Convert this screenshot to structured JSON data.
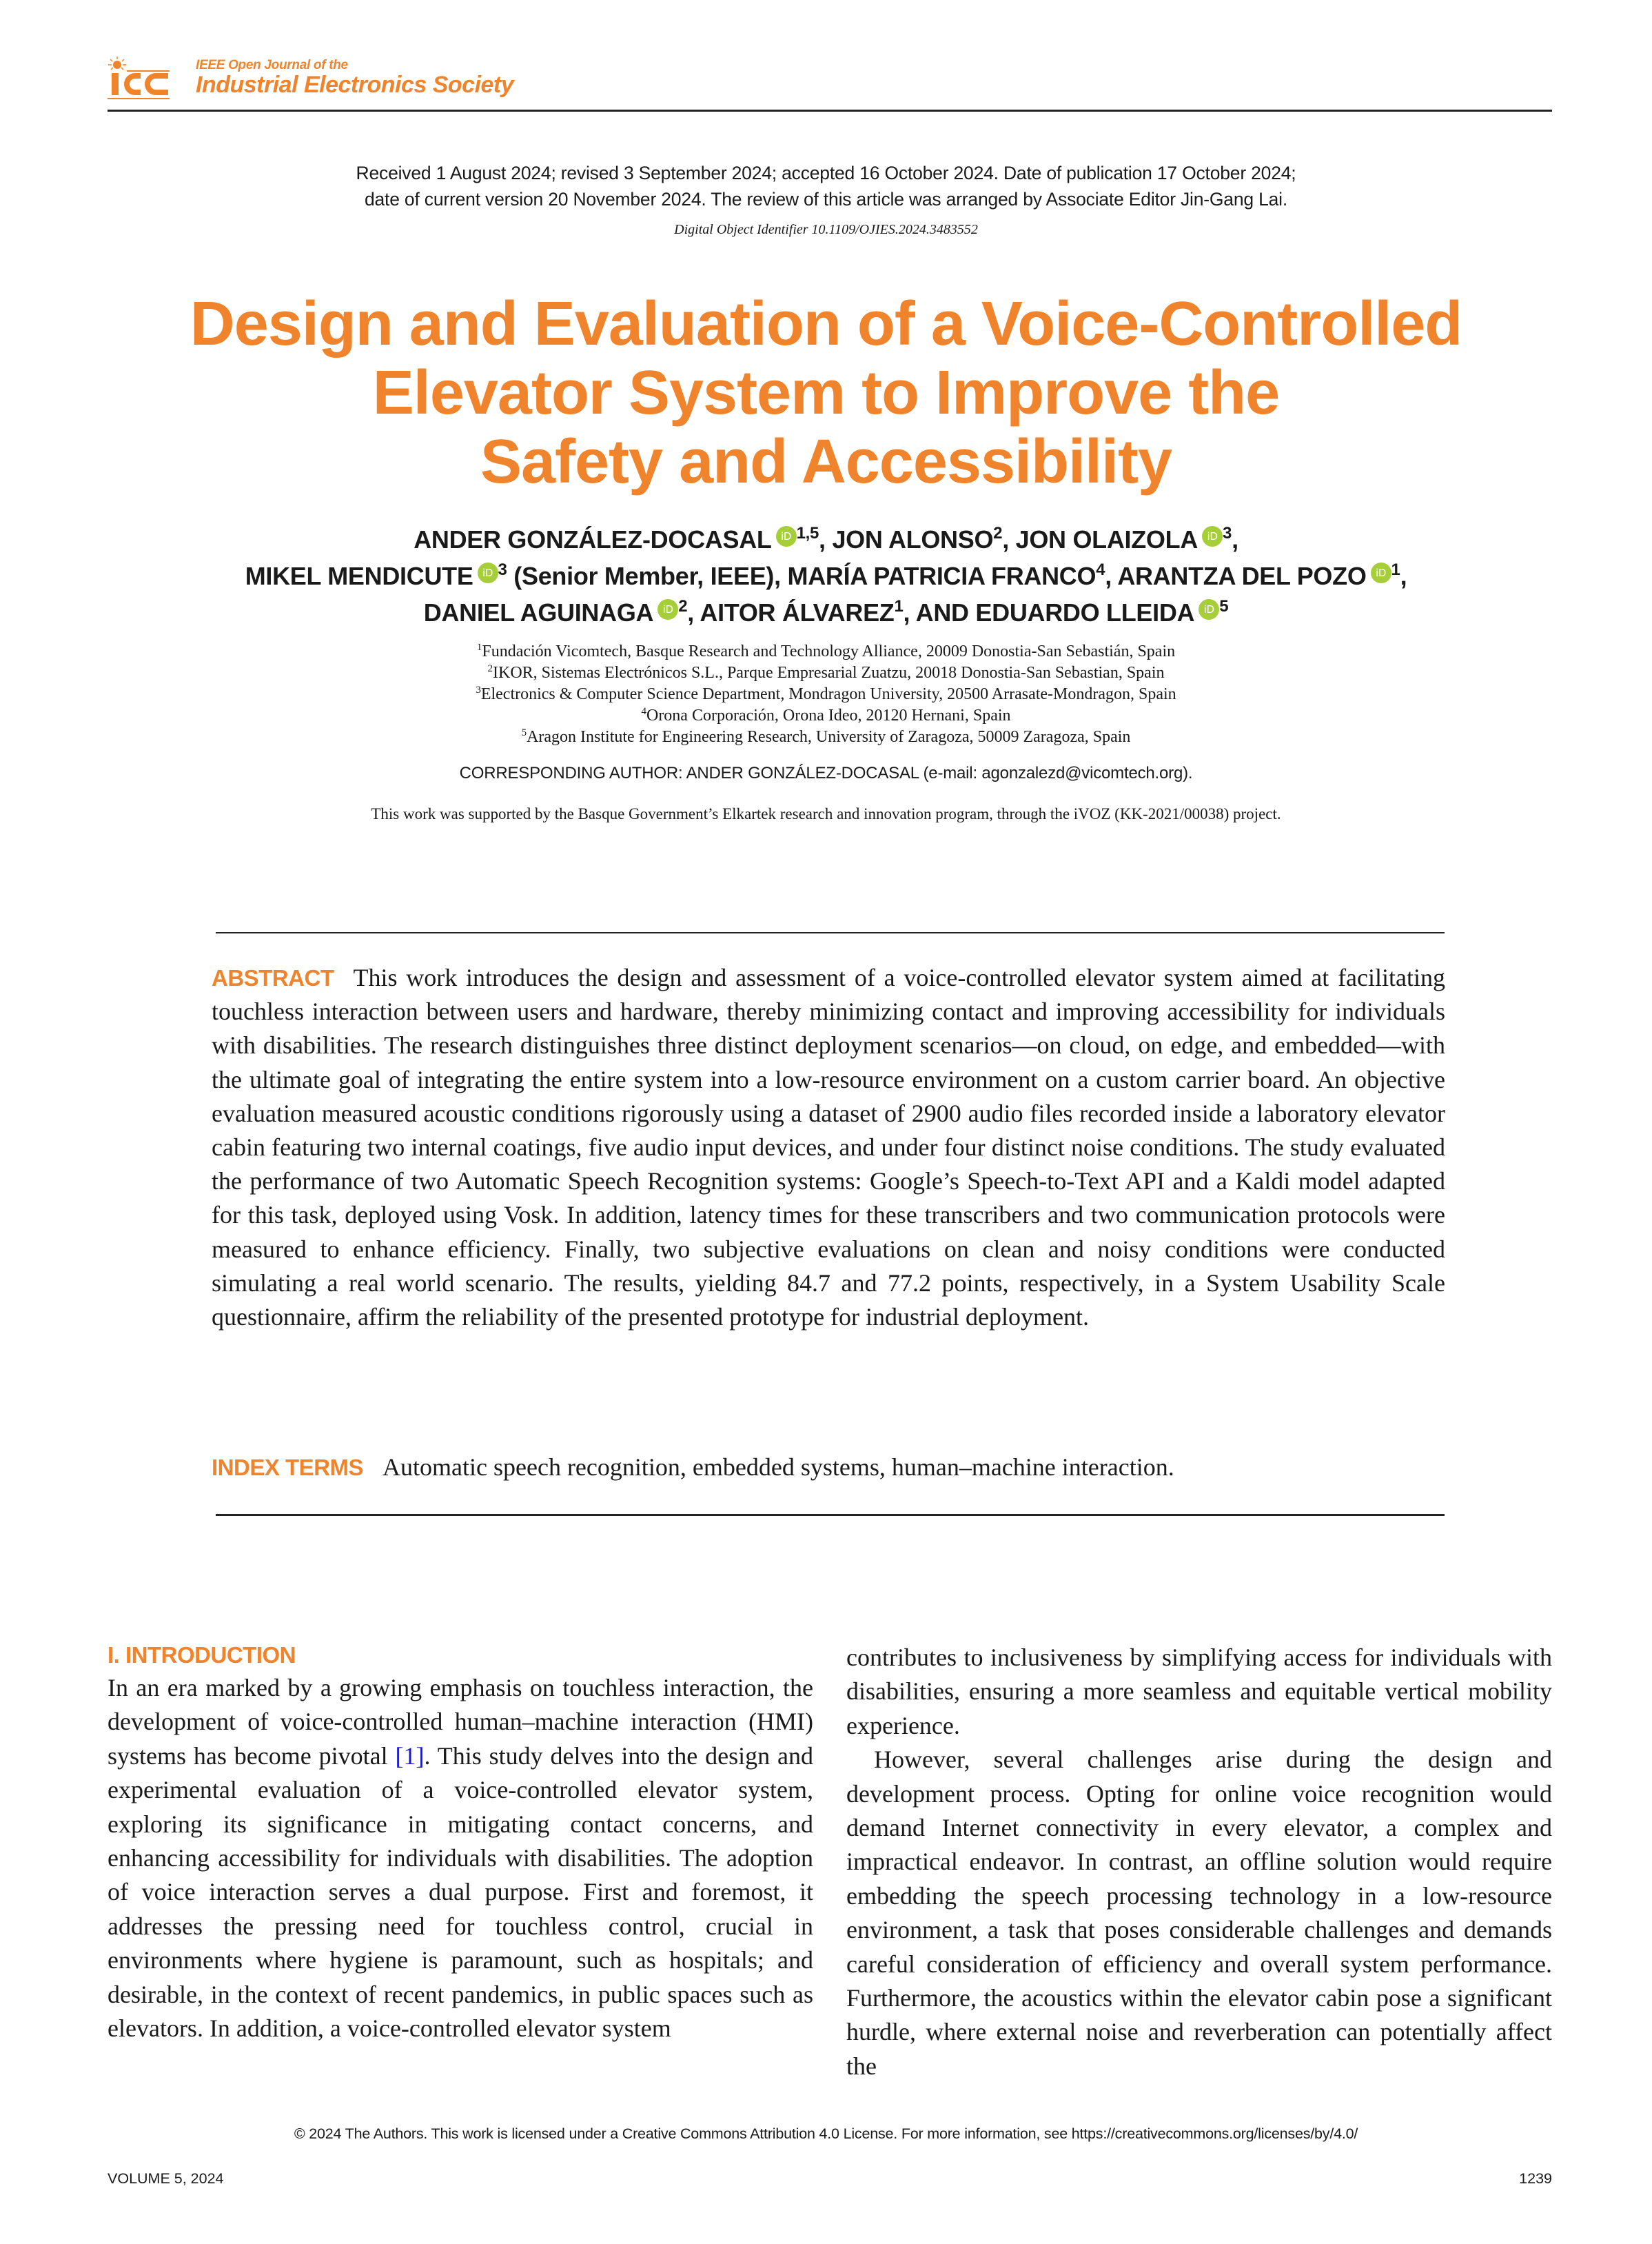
{
  "header": {
    "logo_icon": "ies-logo-icon",
    "journal_line1": "IEEE Open Journal of the",
    "journal_line2": "Industrial Electronics Society"
  },
  "received": {
    "line1": "Received 1 August 2024; revised 3 September 2024; accepted 16 October 2024. Date of publication 17 October 2024;",
    "line2": "date of current version 20 November 2024. The review of this article was arranged by Associate Editor Jin-Gang Lai.",
    "doi": "Digital Object Identifier 10.1109/OJIES.2024.3483552"
  },
  "title": {
    "line1": "Design and Evaluation of a Voice-Controlled",
    "line2": "Elevator System to Improve the",
    "line3": "Safety and Accessibility"
  },
  "authors": [
    {
      "name": "ANDER GONZÁLEZ-DOCASAL",
      "orcid": true,
      "aff": "1,5",
      "suffix": ","
    },
    {
      "name": "JON ALONSO",
      "orcid": false,
      "aff": "2",
      "suffix": ","
    },
    {
      "name": "JON OLAIZOLA",
      "orcid": true,
      "aff": "3",
      "suffix": ","
    },
    {
      "name": "MIKEL MENDICUTE",
      "orcid": true,
      "aff": "3",
      "suffix": " (Senior Member, IEEE),"
    },
    {
      "name": "MARÍA PATRICIA FRANCO",
      "orcid": false,
      "aff": "4",
      "suffix": ","
    },
    {
      "name": "ARANTZA DEL POZO",
      "orcid": true,
      "aff": "1",
      "suffix": ","
    },
    {
      "name": "DANIEL AGUINAGA",
      "orcid": true,
      "aff": "2",
      "suffix": ","
    },
    {
      "name": "AITOR ÁLVAREZ",
      "orcid": false,
      "aff": "1",
      "suffix": ","
    },
    {
      "name": "AND EDUARDO LLEIDA",
      "orcid": true,
      "aff": "5",
      "suffix": ""
    }
  ],
  "orcid_label": "iD",
  "affiliations": [
    {
      "num": "1",
      "text": "Fundación Vicomtech, Basque Research and Technology Alliance, 20009 Donostia-San Sebastián, Spain"
    },
    {
      "num": "2",
      "text": "IKOR, Sistemas Electrónicos S.L., Parque Empresarial Zuatzu, 20018 Donostia-San Sebastian, Spain"
    },
    {
      "num": "3",
      "text": "Electronics & Computer Science Department, Mondragon University, 20500 Arrasate-Mondragon, Spain"
    },
    {
      "num": "4",
      "text": "Orona Corporación, Orona Ideo, 20120 Hernani, Spain"
    },
    {
      "num": "5",
      "text": "Aragon Institute for Engineering Research, University of Zaragoza, 50009 Zaragoza, Spain"
    }
  ],
  "corresponding": "CORRESPONDING AUTHOR: ANDER GONZÁLEZ-DOCASAL (e-mail: agonzalezd@vicomtech.org).",
  "funding": "This work was supported by the Basque Government’s Elkartek research and innovation program, through the iVOZ (KK-2021/00038) project.",
  "abstract": {
    "label": "ABSTRACT",
    "text": "This work introduces the design and assessment of a voice-controlled elevator system aimed at facilitating touchless interaction between users and hardware, thereby minimizing contact and improving accessibility for individuals with disabilities. The research distinguishes three distinct deployment scenarios—on cloud, on edge, and embedded—with the ultimate goal of integrating the entire system into a low-resource environment on a custom carrier board. An objective evaluation measured acoustic conditions rigorously using a dataset of 2900 audio files recorded inside a laboratory elevator cabin featuring two internal coatings, five audio input devices, and under four distinct noise conditions. The study evaluated the performance of two Automatic Speech Recognition systems: Google’s Speech-to-Text API and a Kaldi model adapted for this task, deployed using Vosk. In addition, latency times for these transcribers and two communication protocols were measured to enhance efficiency. Finally, two subjective evaluations on clean and noisy conditions were conducted simulating a real world scenario. The results, yielding 84.7 and 77.2 points, respectively, in a System Usability Scale questionnaire, affirm the reliability of the presented prototype for industrial deployment."
  },
  "index_terms": {
    "label": "INDEX TERMS",
    "text": "Automatic speech recognition, embedded systems, human–machine interaction."
  },
  "introduction": {
    "heading": "I. INTRODUCTION",
    "p1_before_cite": "In an era marked by a growing emphasis on touchless interaction, the development of voice-controlled human–machine interaction (HMI) systems has become pivotal ",
    "p1_cite": "[1]",
    "p1_after_cite": ". This study delves into the design and experimental evaluation of a voice-controlled elevator system, exploring its significance in mitigating contact concerns, and enhancing accessibility for individuals with disabilities. The adoption of voice interaction serves a dual purpose. First and foremost, it addresses the pressing need for touchless control, crucial in environments where hygiene is paramount, such as hospitals; and desirable, in the context of recent pandemics, in public spaces such as elevators. In addition, a voice-controlled elevator system",
    "p1_continued": "contributes to inclusiveness by simplifying access for individuals with disabilities, ensuring a more seamless and equitable vertical mobility experience.",
    "p2": "However, several challenges arise during the design and development process. Opting for online voice recognition would demand Internet connectivity in every elevator, a complex and impractical endeavor. In contrast, an offline solution would require embedding the speech processing technology in a low-resource environment, a task that poses considerable challenges and demands careful consideration of efficiency and overall system performance. Furthermore, the acoustics within the elevator cabin pose a significant hurdle, where external noise and reverberation can potentially affect the"
  },
  "footer": {
    "license": "© 2024 The Authors. This work is licensed under a Creative Commons Attribution 4.0 License. For more information, see https://creativecommons.org/licenses/by/4.0/",
    "volume": "VOLUME 5, 2024",
    "page": "1239"
  },
  "colors": {
    "accent": "#F0842C",
    "orcid": "#A6CE39",
    "citation_link": "#1A1ACC"
  }
}
